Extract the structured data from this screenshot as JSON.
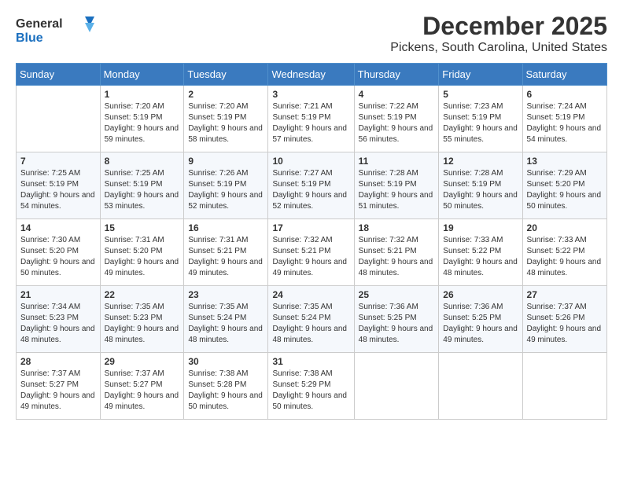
{
  "header": {
    "logo_general": "General",
    "logo_blue": "Blue",
    "month": "December 2025",
    "location": "Pickens, South Carolina, United States"
  },
  "weekdays": [
    "Sunday",
    "Monday",
    "Tuesday",
    "Wednesday",
    "Thursday",
    "Friday",
    "Saturday"
  ],
  "weeks": [
    [
      {
        "day": "",
        "sunrise": "",
        "sunset": "",
        "daylight": ""
      },
      {
        "day": "1",
        "sunrise": "Sunrise: 7:20 AM",
        "sunset": "Sunset: 5:19 PM",
        "daylight": "Daylight: 9 hours and 59 minutes."
      },
      {
        "day": "2",
        "sunrise": "Sunrise: 7:20 AM",
        "sunset": "Sunset: 5:19 PM",
        "daylight": "Daylight: 9 hours and 58 minutes."
      },
      {
        "day": "3",
        "sunrise": "Sunrise: 7:21 AM",
        "sunset": "Sunset: 5:19 PM",
        "daylight": "Daylight: 9 hours and 57 minutes."
      },
      {
        "day": "4",
        "sunrise": "Sunrise: 7:22 AM",
        "sunset": "Sunset: 5:19 PM",
        "daylight": "Daylight: 9 hours and 56 minutes."
      },
      {
        "day": "5",
        "sunrise": "Sunrise: 7:23 AM",
        "sunset": "Sunset: 5:19 PM",
        "daylight": "Daylight: 9 hours and 55 minutes."
      },
      {
        "day": "6",
        "sunrise": "Sunrise: 7:24 AM",
        "sunset": "Sunset: 5:19 PM",
        "daylight": "Daylight: 9 hours and 54 minutes."
      }
    ],
    [
      {
        "day": "7",
        "sunrise": "Sunrise: 7:25 AM",
        "sunset": "Sunset: 5:19 PM",
        "daylight": "Daylight: 9 hours and 54 minutes."
      },
      {
        "day": "8",
        "sunrise": "Sunrise: 7:25 AM",
        "sunset": "Sunset: 5:19 PM",
        "daylight": "Daylight: 9 hours and 53 minutes."
      },
      {
        "day": "9",
        "sunrise": "Sunrise: 7:26 AM",
        "sunset": "Sunset: 5:19 PM",
        "daylight": "Daylight: 9 hours and 52 minutes."
      },
      {
        "day": "10",
        "sunrise": "Sunrise: 7:27 AM",
        "sunset": "Sunset: 5:19 PM",
        "daylight": "Daylight: 9 hours and 52 minutes."
      },
      {
        "day": "11",
        "sunrise": "Sunrise: 7:28 AM",
        "sunset": "Sunset: 5:19 PM",
        "daylight": "Daylight: 9 hours and 51 minutes."
      },
      {
        "day": "12",
        "sunrise": "Sunrise: 7:28 AM",
        "sunset": "Sunset: 5:19 PM",
        "daylight": "Daylight: 9 hours and 50 minutes."
      },
      {
        "day": "13",
        "sunrise": "Sunrise: 7:29 AM",
        "sunset": "Sunset: 5:20 PM",
        "daylight": "Daylight: 9 hours and 50 minutes."
      }
    ],
    [
      {
        "day": "14",
        "sunrise": "Sunrise: 7:30 AM",
        "sunset": "Sunset: 5:20 PM",
        "daylight": "Daylight: 9 hours and 50 minutes."
      },
      {
        "day": "15",
        "sunrise": "Sunrise: 7:31 AM",
        "sunset": "Sunset: 5:20 PM",
        "daylight": "Daylight: 9 hours and 49 minutes."
      },
      {
        "day": "16",
        "sunrise": "Sunrise: 7:31 AM",
        "sunset": "Sunset: 5:21 PM",
        "daylight": "Daylight: 9 hours and 49 minutes."
      },
      {
        "day": "17",
        "sunrise": "Sunrise: 7:32 AM",
        "sunset": "Sunset: 5:21 PM",
        "daylight": "Daylight: 9 hours and 49 minutes."
      },
      {
        "day": "18",
        "sunrise": "Sunrise: 7:32 AM",
        "sunset": "Sunset: 5:21 PM",
        "daylight": "Daylight: 9 hours and 48 minutes."
      },
      {
        "day": "19",
        "sunrise": "Sunrise: 7:33 AM",
        "sunset": "Sunset: 5:22 PM",
        "daylight": "Daylight: 9 hours and 48 minutes."
      },
      {
        "day": "20",
        "sunrise": "Sunrise: 7:33 AM",
        "sunset": "Sunset: 5:22 PM",
        "daylight": "Daylight: 9 hours and 48 minutes."
      }
    ],
    [
      {
        "day": "21",
        "sunrise": "Sunrise: 7:34 AM",
        "sunset": "Sunset: 5:23 PM",
        "daylight": "Daylight: 9 hours and 48 minutes."
      },
      {
        "day": "22",
        "sunrise": "Sunrise: 7:35 AM",
        "sunset": "Sunset: 5:23 PM",
        "daylight": "Daylight: 9 hours and 48 minutes."
      },
      {
        "day": "23",
        "sunrise": "Sunrise: 7:35 AM",
        "sunset": "Sunset: 5:24 PM",
        "daylight": "Daylight: 9 hours and 48 minutes."
      },
      {
        "day": "24",
        "sunrise": "Sunrise: 7:35 AM",
        "sunset": "Sunset: 5:24 PM",
        "daylight": "Daylight: 9 hours and 48 minutes."
      },
      {
        "day": "25",
        "sunrise": "Sunrise: 7:36 AM",
        "sunset": "Sunset: 5:25 PM",
        "daylight": "Daylight: 9 hours and 48 minutes."
      },
      {
        "day": "26",
        "sunrise": "Sunrise: 7:36 AM",
        "sunset": "Sunset: 5:25 PM",
        "daylight": "Daylight: 9 hours and 49 minutes."
      },
      {
        "day": "27",
        "sunrise": "Sunrise: 7:37 AM",
        "sunset": "Sunset: 5:26 PM",
        "daylight": "Daylight: 9 hours and 49 minutes."
      }
    ],
    [
      {
        "day": "28",
        "sunrise": "Sunrise: 7:37 AM",
        "sunset": "Sunset: 5:27 PM",
        "daylight": "Daylight: 9 hours and 49 minutes."
      },
      {
        "day": "29",
        "sunrise": "Sunrise: 7:37 AM",
        "sunset": "Sunset: 5:27 PM",
        "daylight": "Daylight: 9 hours and 49 minutes."
      },
      {
        "day": "30",
        "sunrise": "Sunrise: 7:38 AM",
        "sunset": "Sunset: 5:28 PM",
        "daylight": "Daylight: 9 hours and 50 minutes."
      },
      {
        "day": "31",
        "sunrise": "Sunrise: 7:38 AM",
        "sunset": "Sunset: 5:29 PM",
        "daylight": "Daylight: 9 hours and 50 minutes."
      },
      {
        "day": "",
        "sunrise": "",
        "sunset": "",
        "daylight": ""
      },
      {
        "day": "",
        "sunrise": "",
        "sunset": "",
        "daylight": ""
      },
      {
        "day": "",
        "sunrise": "",
        "sunset": "",
        "daylight": ""
      }
    ]
  ]
}
